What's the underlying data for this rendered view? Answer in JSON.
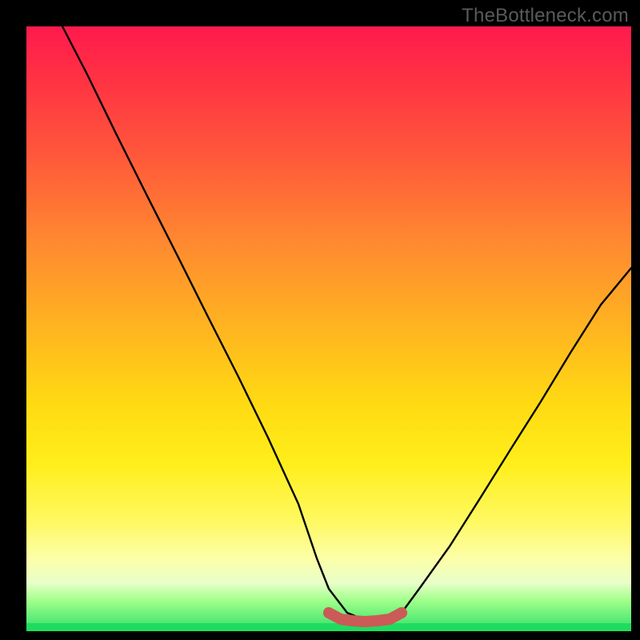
{
  "attribution": "TheBottleneck.com",
  "chart_data": {
    "type": "line",
    "title": "",
    "xlabel": "",
    "ylabel": "",
    "xlim": [
      0,
      100
    ],
    "ylim": [
      0,
      100
    ],
    "series": [
      {
        "name": "black-curve",
        "x": [
          6,
          10,
          15,
          20,
          25,
          30,
          35,
          40,
          45,
          48,
          50,
          53,
          56,
          58,
          60,
          62,
          65,
          70,
          75,
          80,
          85,
          90,
          95,
          100
        ],
        "values": [
          100,
          92,
          82,
          72,
          62,
          52,
          42,
          32,
          21,
          12,
          7,
          3,
          1.8,
          1.6,
          1.8,
          3,
          7,
          14,
          22,
          30,
          38,
          46,
          54,
          60
        ]
      },
      {
        "name": "red-flat-segment",
        "x": [
          50,
          52,
          54,
          56,
          58,
          60,
          62
        ],
        "values": [
          3.0,
          2.0,
          1.7,
          1.6,
          1.7,
          2.0,
          3.0
        ]
      }
    ],
    "colors": {
      "black_curve": "#000000",
      "red_segment": "#cc5a57",
      "gradient_top": "#ff1a4d",
      "gradient_mid": "#ffd913",
      "gradient_bottom": "#1fdc5f"
    }
  }
}
